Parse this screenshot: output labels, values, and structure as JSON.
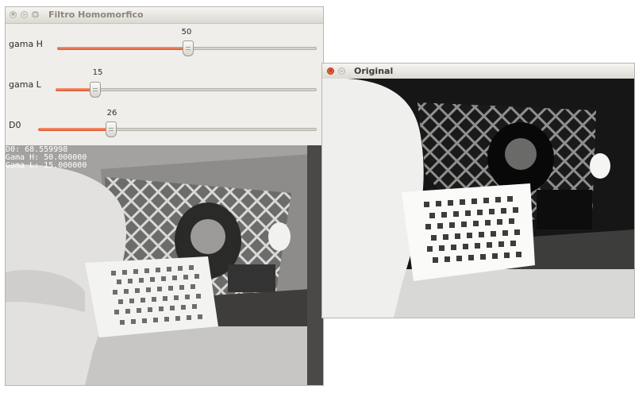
{
  "filtro_window": {
    "title": "Filtro Homomorfico",
    "buttons": [
      "×",
      "–",
      "□"
    ],
    "trackbars": [
      {
        "label": "gama H",
        "value": "50",
        "fraction": 0.5
      },
      {
        "label": "gama L",
        "value": "15",
        "fraction": 0.15
      },
      {
        "label": "D0",
        "value": "26",
        "fraction": 0.26
      }
    ],
    "overlay": {
      "d0": "D0: 68.559998",
      "gama_h": "Gama H: 50.000000",
      "gama_l": "Gama L: 15.000000"
    }
  },
  "original_window": {
    "title": "Original",
    "buttons": [
      "×",
      "–"
    ]
  },
  "colors": {
    "accent": "#e0552d",
    "close_button": "#e9603c",
    "window_bg": "#f0eeea"
  }
}
